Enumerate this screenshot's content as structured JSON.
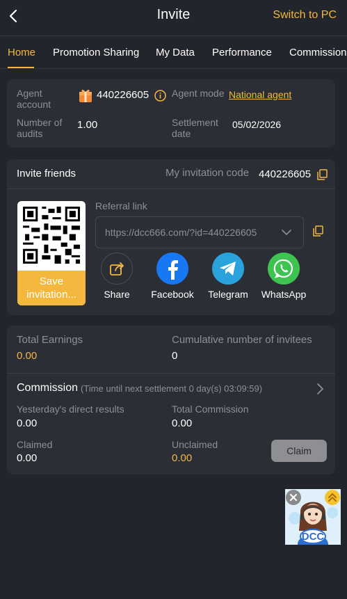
{
  "header": {
    "back_icon": "chevron-left-icon",
    "title": "Invite",
    "switch_pc": "Switch to PC"
  },
  "tabs": [
    {
      "label": "Home",
      "active": true
    },
    {
      "label": "Promotion Sharing",
      "active": false
    },
    {
      "label": "My Data",
      "active": false
    },
    {
      "label": "Performance",
      "active": false
    },
    {
      "label": "Commission",
      "active": false
    }
  ],
  "agent": {
    "account_label_1": "Agent",
    "account_label_2": "account",
    "account_value": "440226605",
    "mode_label": "Agent mode",
    "mode_value": "National agent",
    "audits_label_1": "Number of",
    "audits_label_2": "audits",
    "audits_value": "1.00",
    "settlement_label_1": "Settlement",
    "settlement_label_2": "date",
    "settlement_value": "05/02/2026"
  },
  "invite": {
    "title": "Invite friends",
    "code_label": "My invitation code",
    "code_value": "440226605",
    "save_label_1": "Save",
    "save_label_2": "invitation...",
    "referral_label": "Referral link",
    "referral_link": "https://dcc666.com/?id=440226605",
    "share_items": [
      {
        "label": "Share",
        "icon": "share-icon",
        "color": "#2c2e35"
      },
      {
        "label": "Facebook",
        "icon": "facebook-icon",
        "color": "#1877f2"
      },
      {
        "label": "Telegram",
        "icon": "telegram-icon",
        "color": "#2aa3dd"
      },
      {
        "label": "WhatsApp",
        "icon": "whatsapp-icon",
        "color": "#3dc34f"
      }
    ]
  },
  "earnings": {
    "total_label": "Total Earnings",
    "total_value": "0.00",
    "invitees_label": "Cumulative number of invitees",
    "invitees_value": "0",
    "commission_title": "Commission",
    "commission_note": "(Time until next settlement  0 day(s) 03:09:59)",
    "yesterday_label": "Yesterday's direct results",
    "yesterday_value": "0.00",
    "total_commission_label": "Total Commission",
    "total_commission_value": "0.00",
    "claimed_label": "Claimed",
    "claimed_value": "0.00",
    "unclaimed_label": "Unclaimed",
    "unclaimed_value": "0.00",
    "claim_button": "Claim"
  },
  "widget": {
    "logo_text": "DCC"
  },
  "colors": {
    "accent": "#f4b83e",
    "background": "#23252c",
    "card": "#2c2e35",
    "muted_text": "#8d9098"
  }
}
